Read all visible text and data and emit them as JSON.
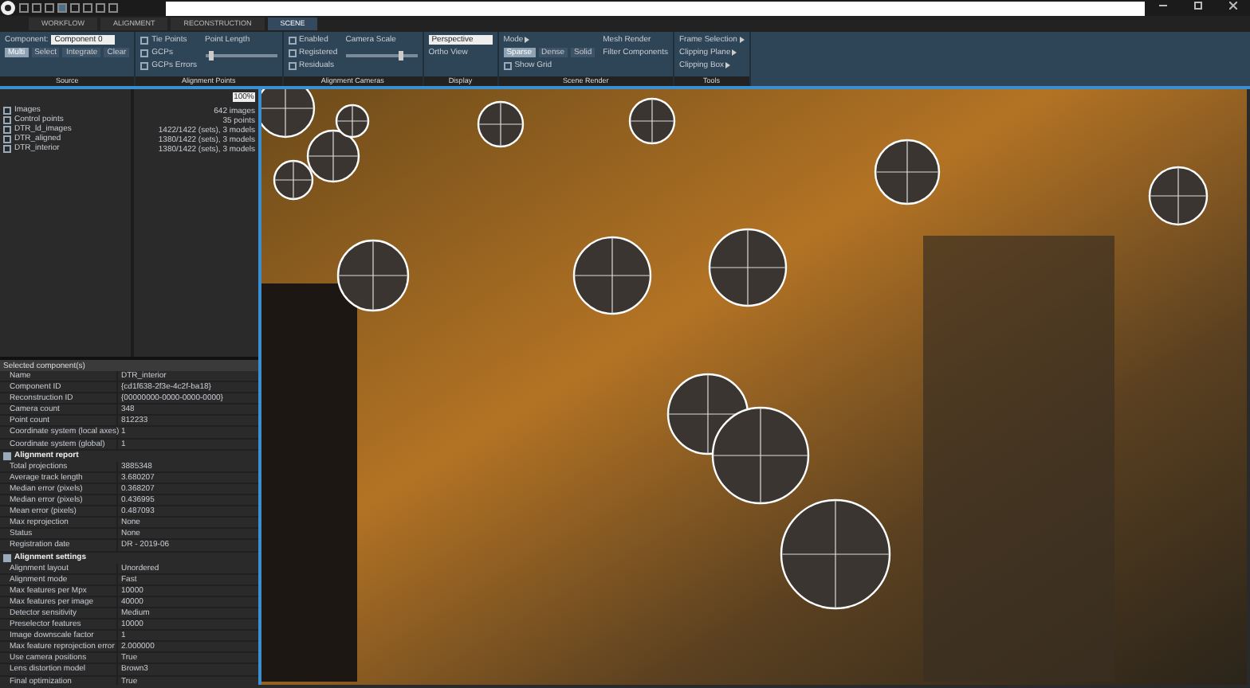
{
  "tabs": [
    {
      "label": "WORKFLOW",
      "selected": false
    },
    {
      "label": "ALIGNMENT",
      "selected": false
    },
    {
      "label": "RECONSTRUCTION",
      "selected": false
    },
    {
      "label": "SCENE",
      "selected": true
    }
  ],
  "ribbon": [
    {
      "title": "Source",
      "columns": [
        [
          {
            "kind": "field",
            "label": "Component:",
            "value": "Component 0"
          },
          {
            "kind": "buttons",
            "items": [
              {
                "label": "Multi",
                "selected": true
              },
              {
                "label": "Select",
                "selected": false
              },
              {
                "label": "Integrate",
                "selected": false
              },
              {
                "label": "Clear",
                "selected": false
              }
            ]
          }
        ]
      ]
    },
    {
      "title": "Alignment Points",
      "columns": [
        [
          {
            "kind": "check",
            "label": "Tie Points",
            "checked": false
          },
          {
            "kind": "check",
            "label": "GCPs",
            "checked": false
          },
          {
            "kind": "check",
            "label": "GCPs Errors",
            "checked": false
          }
        ],
        [
          {
            "kind": "slider",
            "label": "Point Length",
            "level": 0.05
          }
        ]
      ]
    },
    {
      "title": "Alignment Cameras",
      "columns": [
        [
          {
            "kind": "check",
            "label": "Enabled",
            "checked": false
          },
          {
            "kind": "check",
            "label": "Registered",
            "checked": false
          },
          {
            "kind": "check",
            "label": "Residuals",
            "checked": false
          }
        ],
        [
          {
            "kind": "slider",
            "label": "Camera Scale",
            "level": 0.75
          }
        ]
      ]
    },
    {
      "title": "Display",
      "columns": [
        [
          {
            "kind": "field",
            "value": "Perspective"
          },
          {
            "kind": "text",
            "label": "Ortho View"
          }
        ]
      ]
    },
    {
      "title": "Scene Render",
      "columns": [
        [
          {
            "kind": "menu",
            "label": "Mode"
          },
          {
            "kind": "buttons",
            "items": [
              {
                "label": "Sparse",
                "selected": true
              },
              {
                "label": "Dense",
                "selected": false
              },
              {
                "label": "Solid",
                "selected": false
              }
            ]
          },
          {
            "kind": "check",
            "label": "Show Grid",
            "checked": false
          }
        ],
        [
          {
            "kind": "text",
            "label": "Mesh Render"
          },
          {
            "kind": "text",
            "label": "Filter Components"
          }
        ]
      ]
    },
    {
      "title": "Tools",
      "columns": [
        [
          {
            "kind": "menu",
            "label": "Frame Selection"
          },
          {
            "kind": "menu",
            "label": "Clipping Plane"
          },
          {
            "kind": "menu",
            "label": "Clipping Box"
          }
        ]
      ]
    }
  ],
  "tree": [
    {
      "label": "Images"
    },
    {
      "label": "Control points"
    },
    {
      "label": "DTR_ld_images"
    },
    {
      "label": "DTR_aligned"
    },
    {
      "label": "DTR_interior"
    }
  ],
  "summary": {
    "zoom": "100%",
    "rows": [
      "642 images",
      "35 points",
      "1422/1422 (sets), 3 models",
      "1380/1422 (sets), 3 models",
      "1380/1422 (sets), 3 models"
    ]
  },
  "properties": {
    "title": "Selected component(s)",
    "rows": [
      {
        "kind": "row",
        "name": "Name",
        "value": "DTR_interior"
      },
      {
        "kind": "row",
        "name": "Component ID",
        "value": "{cd1f638-2f3e-4c2f-ba18}"
      },
      {
        "kind": "row",
        "name": "Reconstruction ID",
        "value": "{00000000-0000-0000-0000}"
      },
      {
        "kind": "row",
        "name": "Camera count",
        "value": "348"
      },
      {
        "kind": "row",
        "name": "Point count",
        "value": "812233"
      },
      {
        "kind": "row",
        "name": "Coordinate system (local axes)",
        "value": "1"
      },
      {
        "kind": "row",
        "name": "Coordinate system (global)",
        "value": "1"
      },
      {
        "kind": "section",
        "name": "Alignment report"
      },
      {
        "kind": "row",
        "name": "Total projections",
        "value": "3885348"
      },
      {
        "kind": "row",
        "name": "Average track length",
        "value": "3.680207"
      },
      {
        "kind": "row",
        "name": "Median error (pixels)",
        "value": "0.368207"
      },
      {
        "kind": "row",
        "name": "Median error (pixels)",
        "value": "0.436995"
      },
      {
        "kind": "row",
        "name": "Mean error (pixels)",
        "value": "0.487093"
      },
      {
        "kind": "row",
        "name": "Max reprojection",
        "value": "None"
      },
      {
        "kind": "row",
        "name": "Status",
        "value": "None"
      },
      {
        "kind": "row",
        "name": "Registration date",
        "value": "DR - 2019-06"
      },
      {
        "kind": "section",
        "name": "Alignment settings"
      },
      {
        "kind": "row",
        "name": "Alignment layout",
        "value": "Unordered"
      },
      {
        "kind": "row",
        "name": "Alignment mode",
        "value": "Fast"
      },
      {
        "kind": "row",
        "name": "Max features per Mpx",
        "value": "10000"
      },
      {
        "kind": "row",
        "name": "Max features per image",
        "value": "40000"
      },
      {
        "kind": "row",
        "name": "Detector sensitivity",
        "value": "Medium"
      },
      {
        "kind": "row",
        "name": "Preselector features",
        "value": "10000"
      },
      {
        "kind": "row",
        "name": "Image downscale factor",
        "value": "1"
      },
      {
        "kind": "row",
        "name": "Max feature reprojection error",
        "value": "2.000000"
      },
      {
        "kind": "row",
        "name": "Use camera positions",
        "value": "True"
      },
      {
        "kind": "row",
        "name": "Lens distortion model",
        "value": "Brown3"
      },
      {
        "kind": "row",
        "name": "Final optimization",
        "value": "True"
      }
    ]
  }
}
